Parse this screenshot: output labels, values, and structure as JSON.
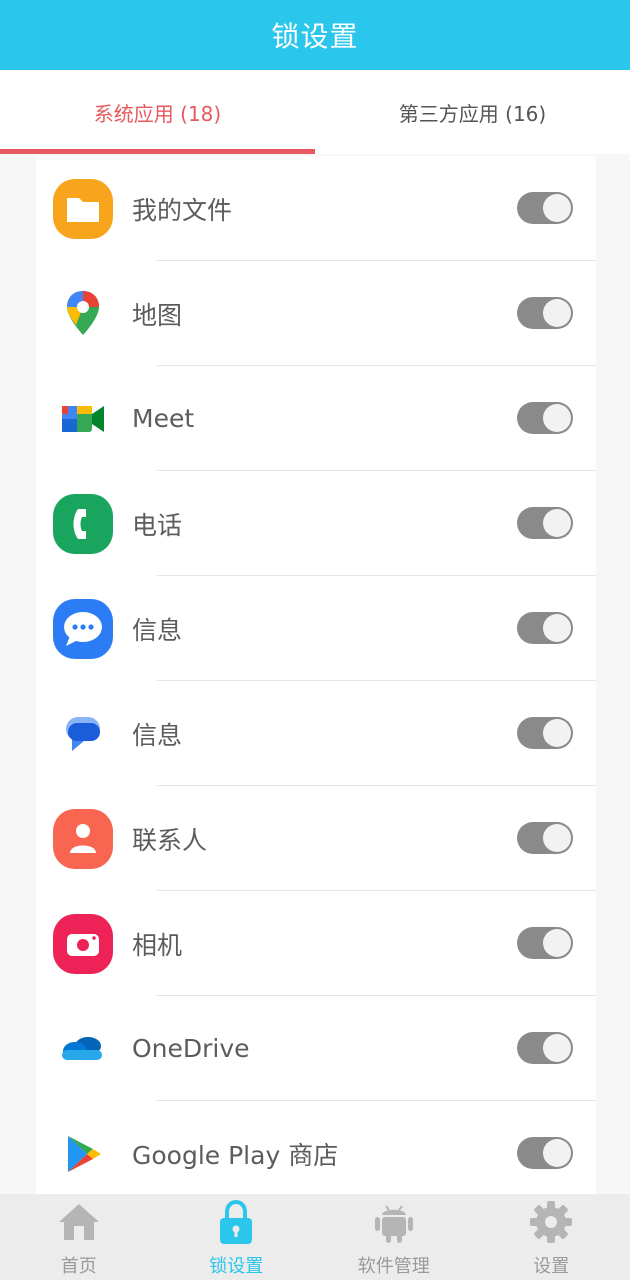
{
  "header": {
    "title": "锁设置"
  },
  "tabs": [
    {
      "label": "系统应用 (18)",
      "active": true
    },
    {
      "label": "第三方应用 (16)",
      "active": false
    }
  ],
  "apps": [
    {
      "name": "我的文件",
      "icon": "folder-icon"
    },
    {
      "name": "地图",
      "icon": "map-pin-icon"
    },
    {
      "name": "Meet",
      "icon": "video-camera-icon"
    },
    {
      "name": "电话",
      "icon": "phone-icon"
    },
    {
      "name": "信息",
      "icon": "chat-bubble-icon"
    },
    {
      "name": "信息",
      "icon": "message-bubble-icon"
    },
    {
      "name": "联系人",
      "icon": "person-icon"
    },
    {
      "name": "相机",
      "icon": "camera-icon"
    },
    {
      "name": "OneDrive",
      "icon": "cloud-icon"
    },
    {
      "name": "Google Play 商店",
      "icon": "play-store-icon"
    }
  ],
  "nav": [
    {
      "label": "首页",
      "icon": "home-icon",
      "active": false
    },
    {
      "label": "锁设置",
      "icon": "lock-icon",
      "active": true
    },
    {
      "label": "软件管理",
      "icon": "android-icon",
      "active": false
    },
    {
      "label": "设置",
      "icon": "gear-icon",
      "active": false
    }
  ],
  "colors": {
    "header": "#2ac6ec",
    "active_tab": "#e8595f",
    "toggle_off": "#8a8a8a",
    "nav_active": "#2ac6ec"
  }
}
